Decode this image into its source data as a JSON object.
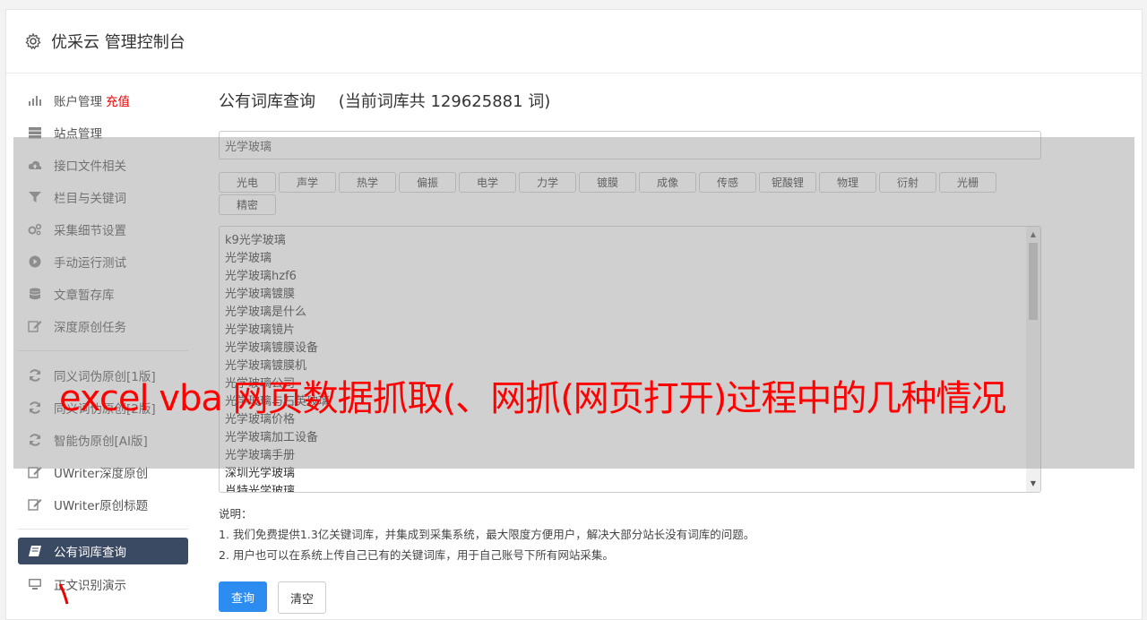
{
  "header": {
    "title": "优采云 管理控制台",
    "icon": "gear-icon"
  },
  "sidebar": {
    "group1": [
      {
        "label": "账户管理",
        "badge": "充值",
        "icon": "bar-chart-icon"
      },
      {
        "label": "站点管理",
        "icon": "server-icon"
      },
      {
        "label": "接口文件相关",
        "icon": "cloud-upload-icon"
      },
      {
        "label": "栏目与关键词",
        "icon": "filter-icon"
      },
      {
        "label": "采集细节设置",
        "icon": "gears-icon"
      },
      {
        "label": "手动运行测试",
        "icon": "play-circle-icon"
      },
      {
        "label": "文章暂存库",
        "icon": "database-icon"
      },
      {
        "label": "深度原创任务",
        "icon": "edit-icon"
      }
    ],
    "group2": [
      {
        "label": "同义词伪原创[1版]",
        "icon": "refresh-icon"
      },
      {
        "label": "同义词伪原创[2版]",
        "icon": "refresh-icon"
      },
      {
        "label": "智能伪原创[AI版]",
        "icon": "refresh-icon"
      },
      {
        "label": "UWriter深度原创",
        "icon": "edit-icon"
      },
      {
        "label": "UWriter原创标题",
        "icon": "edit-icon"
      }
    ],
    "group3": [
      {
        "label": "公有词库查询",
        "icon": "book-icon",
        "active": true
      },
      {
        "label": "正文识别演示",
        "icon": "monitor-icon"
      }
    ]
  },
  "main": {
    "heading": "公有词库查询",
    "count_text": "(当前词库共 129625881 词)",
    "search_value": "光学玻璃",
    "tags": [
      "光电",
      "声学",
      "热学",
      "偏振",
      "电学",
      "力学",
      "镀膜",
      "成像",
      "传感",
      "铌酸锂",
      "物理",
      "衍射",
      "光栅",
      "精密"
    ],
    "words": [
      "k9光学玻璃",
      "光学玻璃",
      "光学玻璃hzf6",
      "光学玻璃镀膜",
      "光学玻璃是什么",
      "光学玻璃镜片",
      "光学玻璃镀膜设备",
      "光学玻璃镀膜机",
      "光学玻璃公司",
      "光学玻璃与石英玻璃",
      "光学玻璃价格",
      "光学玻璃加工设备",
      "光学玻璃手册",
      "深圳光学玻璃",
      "肖特光学玻璃"
    ],
    "notes_title": "说明：",
    "notes": [
      "1. 我们免费提供1.3亿关键词库，并集成到采集系统，最大限度方便用户，解决大部分站长没有词库的问题。",
      "2. 用户也可以在系统上传自己已有的关键词库，用于自己账号下所有网站采集。"
    ],
    "query_button": "查询",
    "clear_button": "清空"
  },
  "overlay_caption": "excel vba 网页数据抓取(、网抓(网页打开)过程中的几种情况"
}
